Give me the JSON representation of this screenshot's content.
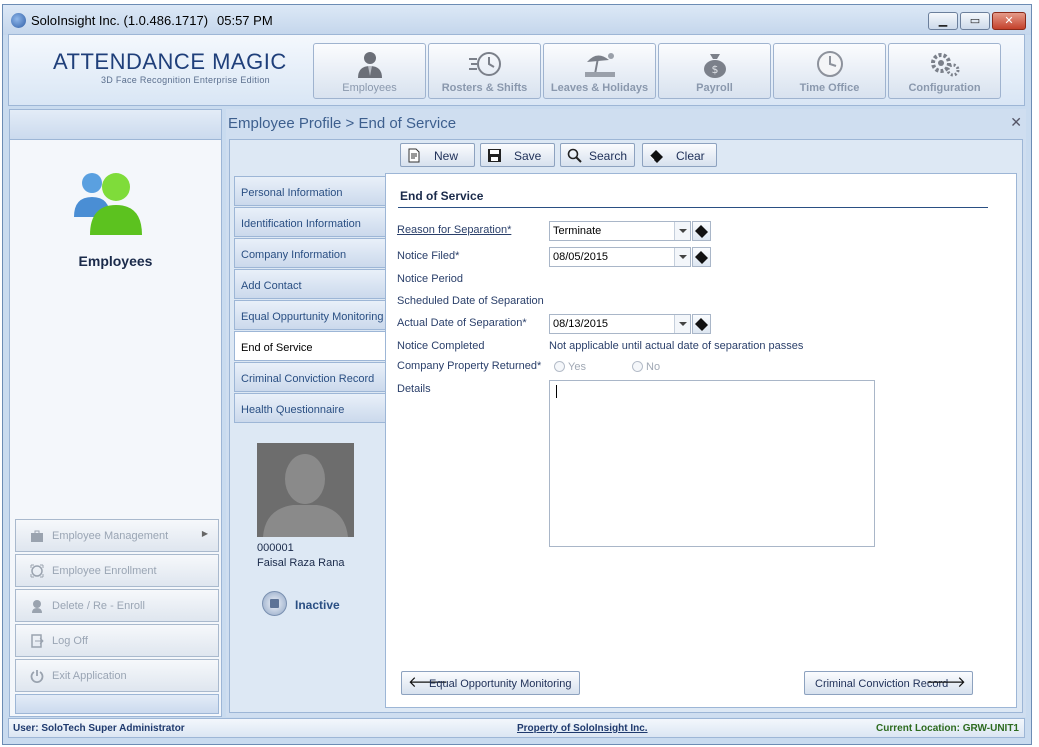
{
  "window": {
    "title": "SoloInsight Inc. (1.0.486.1717)",
    "time": "05:57 PM"
  },
  "header": {
    "logo_title": "ATTENDANCE MAGIC",
    "logo_subtitle": "3D Face Recognition Enterprise Edition",
    "nav": [
      {
        "label": "Employees",
        "icon": "employee-icon"
      },
      {
        "label": "Rosters & Shifts",
        "icon": "clock-icon"
      },
      {
        "label": "Leaves & Holidays",
        "icon": "beach-icon"
      },
      {
        "label": "Payroll",
        "icon": "money-bag-icon"
      },
      {
        "label": "Time Office",
        "icon": "wall-clock-icon"
      },
      {
        "label": "Configuration",
        "icon": "gears-icon"
      }
    ]
  },
  "sidebar": {
    "title": "Employees",
    "menu": [
      {
        "label": "Employee Management",
        "icon": "briefcase-icon"
      },
      {
        "label": "Employee Enrollment",
        "icon": "face-scan-icon"
      },
      {
        "label": "Delete / Re - Enroll",
        "icon": "user-remove-icon"
      },
      {
        "label": "Log Off",
        "icon": "logoff-icon"
      },
      {
        "label": "Exit Application",
        "icon": "power-icon"
      }
    ]
  },
  "main": {
    "breadcrumb": "Employee Profile > End of Service",
    "toolbar": {
      "new": "New",
      "save": "Save",
      "search": "Search",
      "clear": "Clear"
    },
    "tabs": [
      "Personal Information",
      "Identification Information",
      "Company Information",
      "Add Contact",
      "Equal Oppurtunity Monitoring",
      "End of Service",
      "Criminal Conviction Record",
      "Health Questionnaire"
    ],
    "employee": {
      "id": "000001",
      "name": "Faisal Raza Rana",
      "status": "Inactive"
    },
    "form": {
      "title": "End of Service",
      "reason_label": "Reason for Separation*",
      "reason_value": "Terminate",
      "notice_filed_label": "Notice Filed*",
      "notice_filed_value": "08/05/2015",
      "notice_period_label": "Notice Period",
      "scheduled_label": "Scheduled Date of Separation",
      "actual_label": "Actual Date of Separation*",
      "actual_value": "08/13/2015",
      "notice_completed_label": "Notice Completed",
      "notice_completed_value": "Not applicable until actual date of separation passes",
      "property_label": "Company Property Returned*",
      "property_yes": "Yes",
      "property_no": "No",
      "details_label": "Details",
      "details_value": ""
    },
    "nav_prev": "Equal Opportunity Monitoring",
    "nav_next": "Criminal Conviction Record"
  },
  "statusbar": {
    "user": "User: SoloTech    Super Administrator",
    "property": "Property of SoloInsight Inc.",
    "location": "Current Location: GRW-UNIT1"
  }
}
